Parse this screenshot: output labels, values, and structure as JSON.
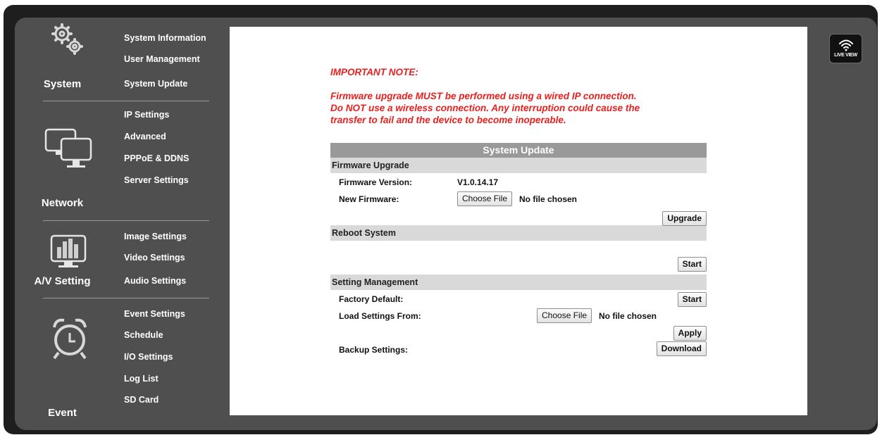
{
  "sidebar": {
    "system": {
      "label": "System",
      "icon": "gears-icon",
      "items": [
        "System Information",
        "User Management",
        "System Update"
      ]
    },
    "network": {
      "label": "Network",
      "icon": "monitors-icon",
      "items": [
        "IP Settings",
        "Advanced",
        "PPPoE & DDNS",
        "Server Settings"
      ]
    },
    "av": {
      "label": "A/V Setting",
      "icon": "equalizer-monitor-icon",
      "items": [
        "Image Settings",
        "Video Settings",
        "Audio Settings"
      ]
    },
    "event": {
      "label": "Event",
      "icon": "alarm-clock-icon",
      "items": [
        "Event Settings",
        "Schedule",
        "I/O Settings",
        "Log List",
        "SD Card"
      ]
    }
  },
  "live_view": {
    "label": "LIVE VIEW",
    "icon": "wifi-icon"
  },
  "note": {
    "title": "IMPORTANT NOTE:",
    "lines": [
      "Firmware upgrade MUST be performed using a wired IP connection.",
      "Do NOT use a wireless connection. Any interruption could cause the",
      "transfer to fail and the device to become inoperable."
    ]
  },
  "panel": {
    "title": "System Update",
    "firmware": {
      "header": "Firmware Upgrade",
      "version_label": "Firmware Version:",
      "version_value": "V1.0.14.17",
      "new_label": "New Firmware:",
      "choose_label": "Choose File",
      "no_file": "No file chosen",
      "upgrade_label": "Upgrade"
    },
    "reboot": {
      "header": "Reboot System",
      "start_label": "Start"
    },
    "settings": {
      "header": "Setting Management",
      "factory_label": "Factory Default:",
      "factory_button": "Start",
      "load_label": "Load Settings From:",
      "choose_label": "Choose File",
      "no_file": "No file chosen",
      "apply_label": "Apply",
      "backup_label": "Backup Settings:",
      "download_label": "Download"
    }
  }
}
